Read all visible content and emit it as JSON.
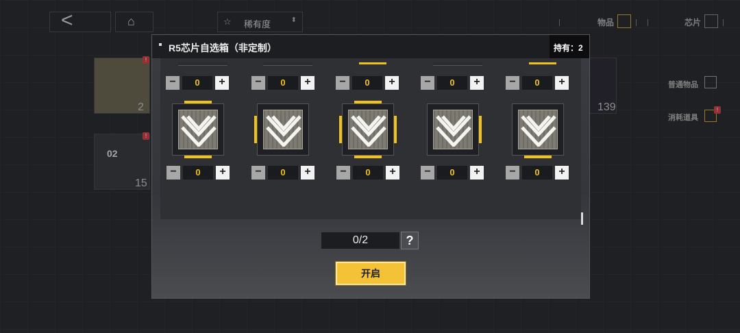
{
  "topbar": {
    "rarity_label": "稀有度",
    "tab_items": "物品",
    "tab_chips": "芯片"
  },
  "background": {
    "items": [
      {
        "count": "2"
      },
      {
        "count": "15"
      },
      {
        "count": "139"
      }
    ],
    "item2_label": "02",
    "badge": "!",
    "side_tabs": [
      "普通物品",
      "消耗道具"
    ]
  },
  "dialog": {
    "title": "R5芯片自选箱（非定制）",
    "held": "持有：2",
    "top_row_values": [
      "0",
      "0",
      "0",
      "0",
      "0"
    ],
    "chips": [
      {
        "value": "0",
        "highlight": "top-bottom"
      },
      {
        "value": "0",
        "highlight": "left"
      },
      {
        "value": "0",
        "highlight": "all"
      },
      {
        "value": "0",
        "highlight": "right"
      },
      {
        "value": "0",
        "highlight": "bottom"
      }
    ],
    "selection_counter": "0/2",
    "help_label": "?",
    "open_label": "开启",
    "stepper_minus": "−",
    "stepper_plus": "+"
  },
  "colors": {
    "accent": "#f1c21b",
    "panel": "#1d1e21"
  }
}
